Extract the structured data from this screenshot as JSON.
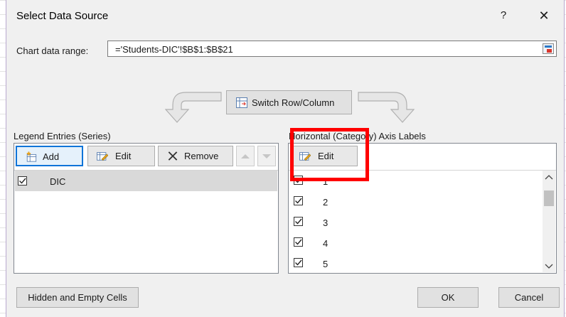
{
  "dialog": {
    "title": "Select Data Source",
    "help_label": "?",
    "close_label": "✕"
  },
  "range": {
    "label": "Chart data range:",
    "value": "='Students-DIC'!$B$1:$B$21"
  },
  "switch_button": {
    "label": "Switch Row/Column"
  },
  "legend": {
    "group_label": "Legend Entries (Series)",
    "add_label": "Add",
    "edit_label": "Edit",
    "remove_label": "Remove",
    "series": [
      {
        "name": "DIC",
        "checked": true
      }
    ]
  },
  "axis": {
    "group_label": "Horizontal (Category) Axis Labels",
    "edit_label": "Edit",
    "items": [
      "1",
      "2",
      "3",
      "4",
      "5"
    ]
  },
  "footer": {
    "hidden_empty_label": "Hidden and Empty Cells",
    "ok_label": "OK",
    "cancel_label": "Cancel"
  },
  "colors": {
    "highlight": "#ff0000",
    "primary_button_border": "#0f74d8"
  },
  "icons": [
    "switch-row-column-icon",
    "add-series-icon",
    "edit-icon",
    "remove-x-icon",
    "move-up-icon",
    "move-down-icon",
    "collapse-range-icon",
    "checkbox-checked-icon"
  ]
}
